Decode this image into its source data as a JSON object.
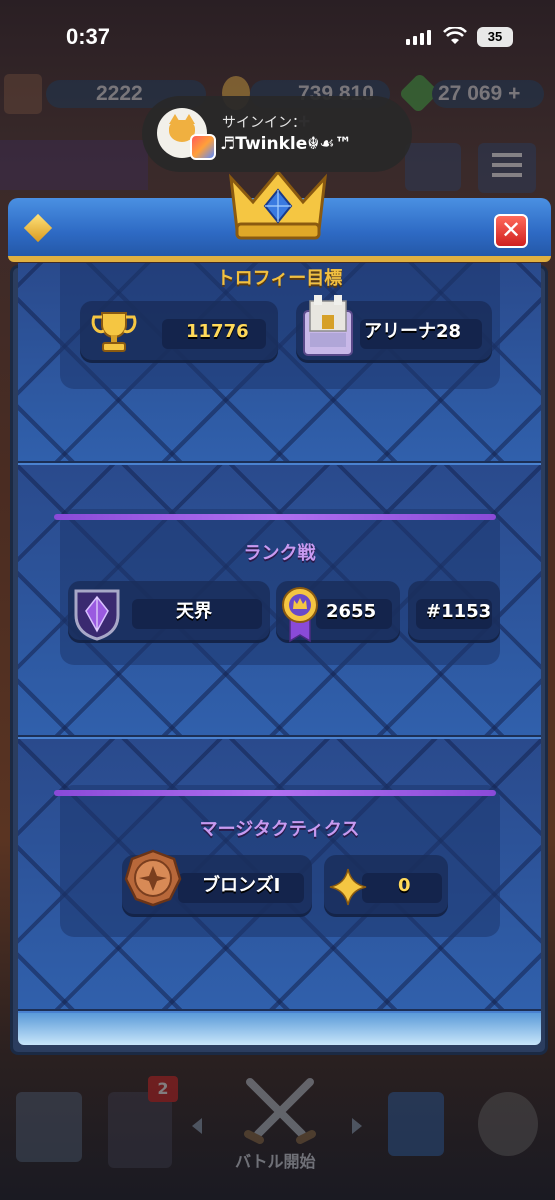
{
  "status_bar": {
    "time": "0:37",
    "battery": "35"
  },
  "topbar": {
    "trophies": "2222",
    "gold": "739 810 +",
    "gems": "27 069 +"
  },
  "notification": {
    "title": "サインイン：",
    "body": "♬Twinkle☬☙™"
  },
  "trophy_goal": {
    "title": "トロフィー目標",
    "trophies": "11776",
    "arena": "アリーナ28"
  },
  "ranked": {
    "title": "ランク戦",
    "league": "天界",
    "medals": "2655",
    "rank": "#1153"
  },
  "merge_tactics": {
    "title": "マージタクティクス",
    "league": "ブロンズI",
    "stars": "0"
  },
  "bottom_nav": {
    "badge": "2",
    "battle_label": "バトル開始"
  },
  "colors": {
    "header_blue": "#2e6ac4",
    "gold_title": "#f2c040",
    "purple_title": "#c89af0",
    "close_red": "#d02020"
  }
}
